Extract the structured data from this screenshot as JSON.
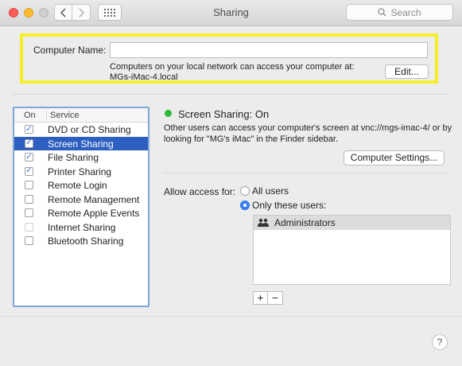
{
  "window": {
    "title": "Sharing"
  },
  "search": {
    "placeholder": "Search"
  },
  "computer_name": {
    "label": "Computer Name:",
    "value": "",
    "info_line1": "Computers on your local network can access your computer at:",
    "info_line2": "MGs-iMac-4.local",
    "edit_label": "Edit..."
  },
  "services": {
    "header_on": "On",
    "header_service": "Service",
    "items": [
      {
        "label": "DVD or CD Sharing",
        "checked": true,
        "selected": false
      },
      {
        "label": "Screen Sharing",
        "checked": true,
        "selected": true
      },
      {
        "label": "File Sharing",
        "checked": true,
        "selected": false
      },
      {
        "label": "Printer Sharing",
        "checked": true,
        "selected": false
      },
      {
        "label": "Remote Login",
        "checked": false,
        "selected": false
      },
      {
        "label": "Remote Management",
        "checked": false,
        "selected": false
      },
      {
        "label": "Remote Apple Events",
        "checked": false,
        "selected": false
      },
      {
        "label": "Internet Sharing",
        "checked": false,
        "selected": false,
        "disabled": true
      },
      {
        "label": "Bluetooth Sharing",
        "checked": false,
        "selected": false
      }
    ]
  },
  "detail": {
    "status_title": "Screen Sharing: On",
    "status_line1": "Other users can access your computer's screen at vnc://mgs-imac-4/ or by",
    "status_line2": "looking for \"MG's iMac\" in the Finder sidebar.",
    "computer_settings_label": "Computer Settings...",
    "access_label": "Allow access for:",
    "option_all": "All users",
    "option_only": "Only these users:",
    "selected_option": "only",
    "users": [
      "Administrators"
    ],
    "add_label": "+",
    "remove_label": "−"
  },
  "help_label": "?",
  "colors": {
    "highlight": "#f4ef2a",
    "selection": "#2d5fc1",
    "status_on": "#2bbb3a"
  }
}
